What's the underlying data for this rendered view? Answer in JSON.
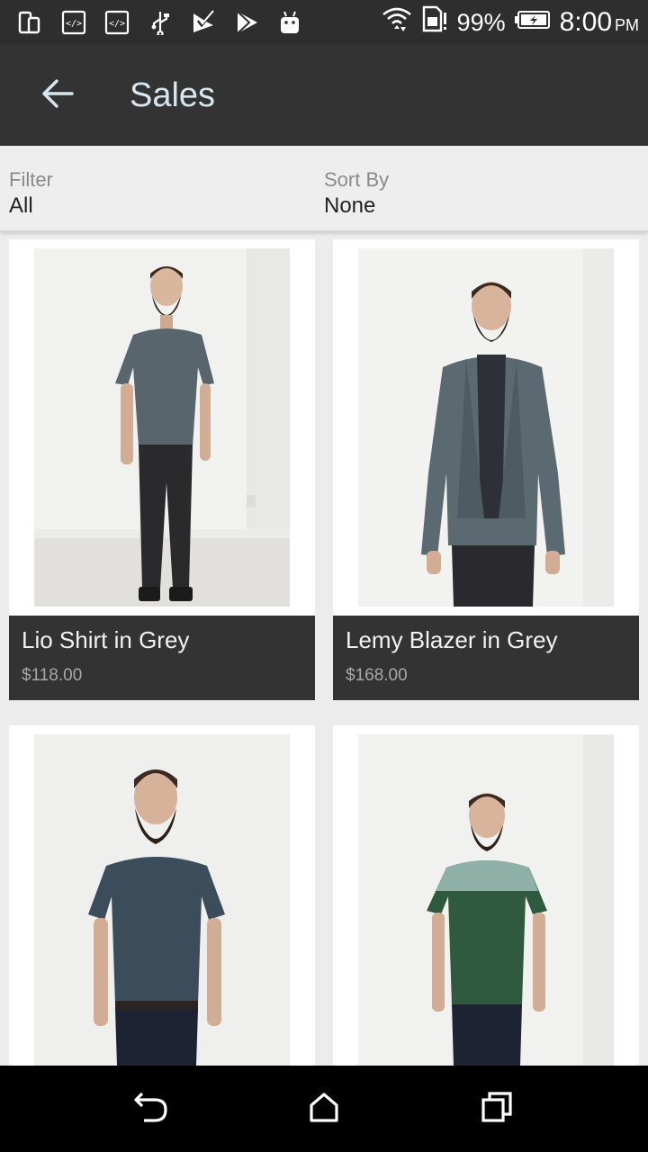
{
  "status_bar": {
    "battery_percent": "99%",
    "time": "8:00",
    "ampm": "PM",
    "icons": [
      "phone-tablet-icon",
      "code-icon",
      "code-icon",
      "usb-icon",
      "check-box-icon",
      "play-store-icon",
      "android-icon",
      "wifi-icon",
      "sim-icon",
      "battery-charging-icon"
    ]
  },
  "app_bar": {
    "title": "Sales",
    "back_icon": "arrow-left-icon"
  },
  "filter_bar": {
    "filter_label": "Filter",
    "filter_value": "All",
    "sort_label": "Sort By",
    "sort_value": "None"
  },
  "products": [
    {
      "name": "Lio Shirt in Grey",
      "price": "$118.00"
    },
    {
      "name": "Lemy Blazer in Grey",
      "price": "$168.00"
    },
    {
      "name": "",
      "price": ""
    },
    {
      "name": "",
      "price": ""
    }
  ],
  "nav_bar": {
    "icons": [
      "back-nav-icon",
      "home-nav-icon",
      "recents-nav-icon"
    ]
  },
  "colors": {
    "status_bar": "#2e2e2e",
    "app_bar": "#333333",
    "caption_bg": "#333333",
    "title_text": "#d8e6f0",
    "background": "#ececec"
  }
}
